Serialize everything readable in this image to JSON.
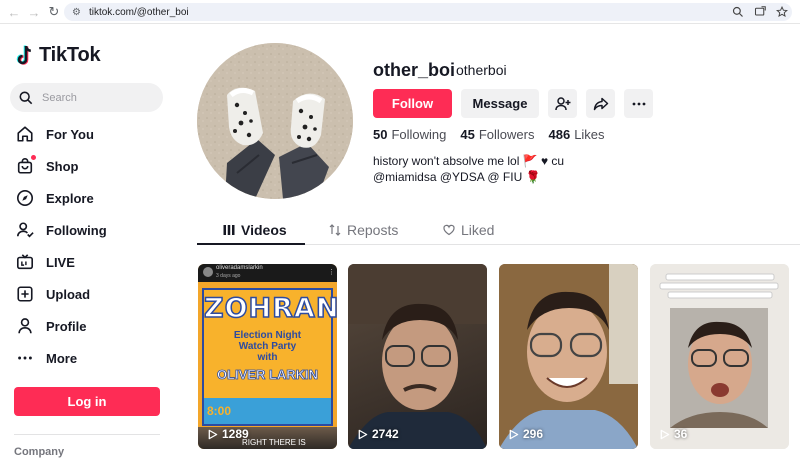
{
  "browser": {
    "url": "tiktok.com/@other_boi"
  },
  "sidebar": {
    "logo_text": "TikTok",
    "search_placeholder": "Search",
    "items": [
      {
        "label": "For You",
        "icon": "home-icon"
      },
      {
        "label": "Shop",
        "icon": "shop-icon"
      },
      {
        "label": "Explore",
        "icon": "compass-icon"
      },
      {
        "label": "Following",
        "icon": "following-icon"
      },
      {
        "label": "LIVE",
        "icon": "live-icon"
      },
      {
        "label": "Upload",
        "icon": "upload-icon"
      },
      {
        "label": "Profile",
        "icon": "profile-icon"
      },
      {
        "label": "More",
        "icon": "more-icon"
      }
    ],
    "login_label": "Log in",
    "company_label": "Company"
  },
  "profile": {
    "username": "other_boi",
    "nickname": "otherboi",
    "follow_label": "Follow",
    "message_label": "Message",
    "stats": {
      "following_count": "50",
      "following_label": "Following",
      "followers_count": "45",
      "followers_label": "Followers",
      "likes_count": "486",
      "likes_label": "Likes"
    },
    "bio_line1": "history won't absolve me lol 🚩 ♥ cu",
    "bio_line2": "@miamidsa @YDSA @ FIU 🌹"
  },
  "tabs": [
    {
      "label": "Videos",
      "icon": "grid-icon"
    },
    {
      "label": "Reposts",
      "icon": "repost-icon"
    },
    {
      "label": "Liked",
      "icon": "heart-icon"
    }
  ],
  "videos": [
    {
      "views": "1289",
      "overlay_user": "oliveradamslarkin",
      "overlay_time": "3 days ago",
      "poster_title": "ZOHRAN",
      "poster_sub1": "Election Night",
      "poster_sub2": "Watch Party",
      "poster_sub3": "with",
      "poster_name": "OLIVER LARKIN",
      "poster_time": "8:00",
      "poster_caption": "RIGHT THERE IS"
    },
    {
      "views": "2742"
    },
    {
      "views": "296"
    },
    {
      "views": "36"
    }
  ],
  "colors": {
    "accent": "#fe2c55",
    "text": "#161823",
    "muted": "#75767d"
  }
}
